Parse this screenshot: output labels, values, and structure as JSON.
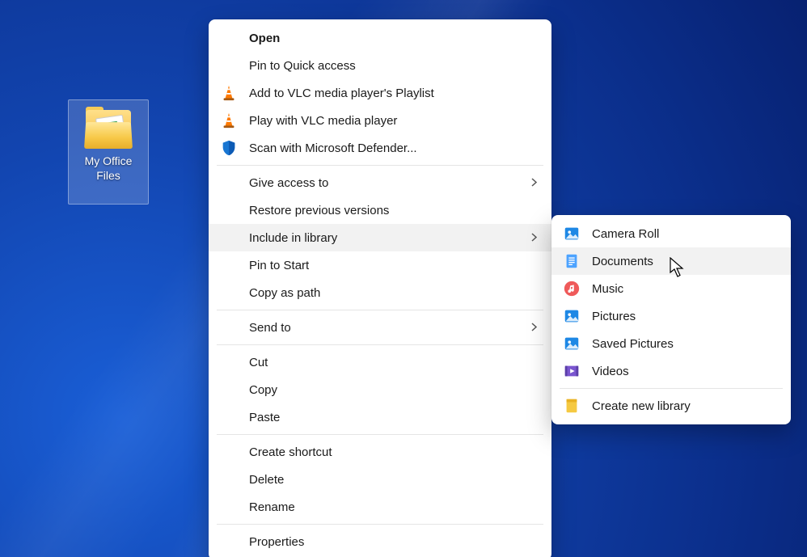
{
  "desktop_icon": {
    "label": "My Office\nFiles"
  },
  "context_menu": {
    "open": "Open",
    "pin_quick": "Pin to Quick access",
    "vlc_add": "Add to VLC media player's Playlist",
    "vlc_play": "Play with VLC media player",
    "defender": "Scan with Microsoft Defender...",
    "give_access": "Give access to",
    "restore_prev": "Restore previous versions",
    "include_lib": "Include in library",
    "pin_start": "Pin to Start",
    "copy_path": "Copy as path",
    "send_to": "Send to",
    "cut": "Cut",
    "copy": "Copy",
    "paste": "Paste",
    "shortcut": "Create shortcut",
    "delete": "Delete",
    "rename": "Rename",
    "properties": "Properties"
  },
  "library_submenu": {
    "camera_roll": "Camera Roll",
    "documents": "Documents",
    "music": "Music",
    "pictures": "Pictures",
    "saved_pictures": "Saved Pictures",
    "videos": "Videos",
    "create_new": "Create new library"
  }
}
